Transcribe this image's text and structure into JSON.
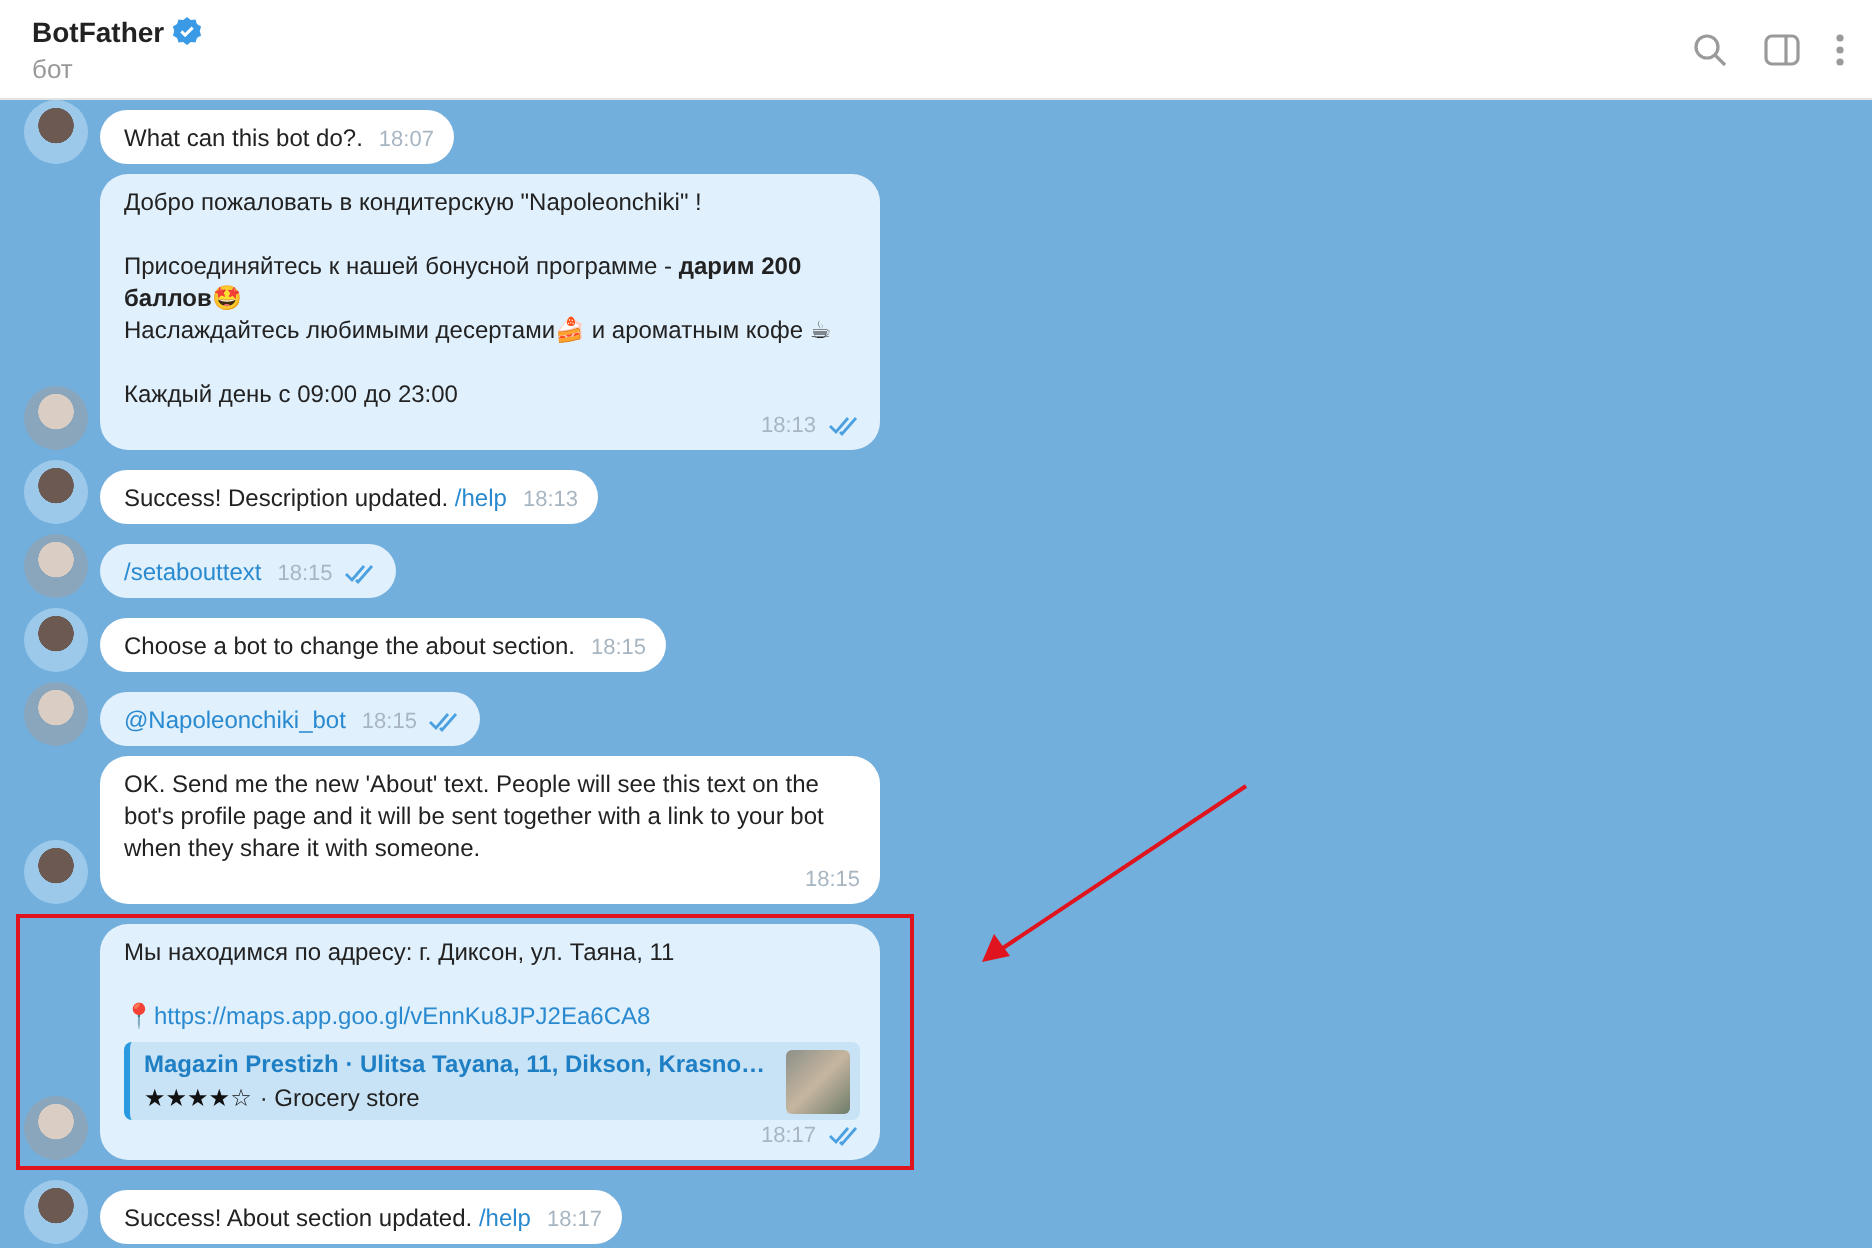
{
  "header": {
    "title": "BotFather",
    "verified": true,
    "subtitle": "бот"
  },
  "messages": [
    {
      "kind": "incoming",
      "parts": [
        {
          "kind": "text",
          "text": "What can this bot do?."
        }
      ],
      "time": "18:07",
      "highlighted": false
    },
    {
      "kind": "outgoing",
      "read": true,
      "parts": [
        {
          "kind": "text",
          "text": "Добро пожаловать в кондитерскую \"Napoleonchiki\" !\n\nПрисоединяйтесь к нашей бонусной программе - **дарим 200 баллов**🤩\nНаслаждайтесь любимыми десертами🍰 и ароматным кофе ☕\n\nКаждый день с 09:00 до 23:00"
        }
      ],
      "time": "18:13",
      "highlighted": false
    },
    {
      "kind": "incoming",
      "parts": [
        {
          "kind": "text",
          "text": "Success! Description updated. "
        },
        {
          "kind": "link",
          "text": "/help"
        }
      ],
      "time": "18:13",
      "highlighted": false
    },
    {
      "kind": "outgoing",
      "read": true,
      "parts": [
        {
          "kind": "link",
          "text": "/setabouttext"
        }
      ],
      "time": "18:15",
      "highlighted": false
    },
    {
      "kind": "incoming",
      "parts": [
        {
          "kind": "text",
          "text": "Choose a bot to change the about section."
        }
      ],
      "time": "18:15",
      "highlighted": false
    },
    {
      "kind": "outgoing",
      "read": true,
      "parts": [
        {
          "kind": "link",
          "text": "@Napoleonchiki_bot"
        }
      ],
      "time": "18:15",
      "highlighted": false
    },
    {
      "kind": "incoming",
      "parts": [
        {
          "kind": "text",
          "text": "OK. Send me the new 'About' text. People will see this text on the bot's profile page and it will be sent together with a link to your bot when they share it with someone."
        }
      ],
      "time": "18:15",
      "highlighted": false
    },
    {
      "kind": "outgoing",
      "read": true,
      "parts": [
        {
          "kind": "text",
          "text": "Мы находимся по адресу: г. Диксон, ул. Таяна, 11"
        },
        {
          "kind": "paragraph_break"
        },
        {
          "kind": "text",
          "text": "📍"
        },
        {
          "kind": "link",
          "text": "https://maps.app.goo.gl/vEnnKu8JPJ2Ea6CA8"
        }
      ],
      "preview": {
        "title": "Magazin Prestizh · Ulitsa Tayana, 11, Dikson, Krasno…",
        "stars": 4,
        "subtitle": "· Grocery store"
      },
      "time": "18:17",
      "highlighted": true
    },
    {
      "kind": "incoming",
      "parts": [
        {
          "kind": "text",
          "text": "Success! About section updated. "
        },
        {
          "kind": "link",
          "text": "/help"
        }
      ],
      "time": "18:17",
      "highlighted": false
    }
  ],
  "annotation": {
    "kind": "arrow"
  }
}
